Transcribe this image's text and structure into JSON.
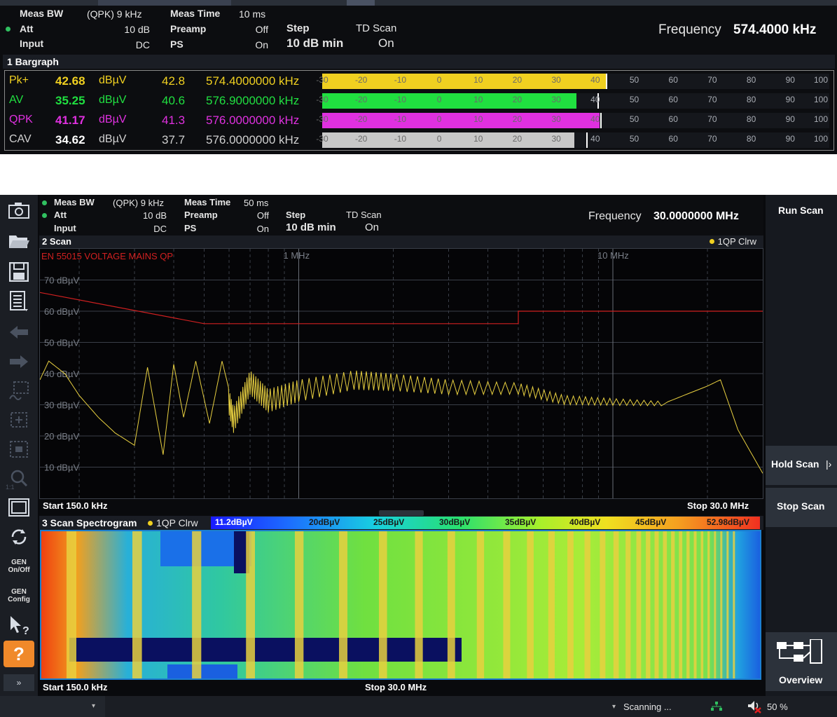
{
  "top": {
    "settings": {
      "meas_bw_label": "Meas BW",
      "meas_bw_value": "(QPK) 9 kHz",
      "att_label": "Att",
      "att_value": "10 dB",
      "input_label": "Input",
      "input_value": "DC",
      "meas_time_label": "Meas Time",
      "meas_time_value": "10 ms",
      "preamp_label": "Preamp",
      "preamp_value": "Off",
      "ps_label": "PS",
      "ps_value": "On",
      "step_label": "Step",
      "step_value": "10 dB min",
      "td_scan_label": "TD Scan",
      "td_scan_value": "On"
    },
    "frequency_label": "Frequency",
    "frequency_value": "574.4000 kHz",
    "bargraph_title": "1 Bargraph",
    "scale_ticks": [
      "-30",
      "-20",
      "-10",
      "0",
      "10",
      "20",
      "30",
      "40",
      "50",
      "60",
      "70",
      "80",
      "90",
      "100"
    ],
    "scale_min": -30,
    "scale_max": 100,
    "rows": [
      {
        "detector": "Pk+",
        "value": "42.68",
        "unit": "dBµV",
        "peak": "42.8",
        "peak_freq": "574.4000000 kHz",
        "level": 42.68,
        "color": "#f0d020"
      },
      {
        "detector": "AV",
        "value": "35.25",
        "unit": "dBµV",
        "peak": "40.6",
        "peak_freq": "576.9000000 kHz",
        "level": 35.25,
        "color": "#20e040"
      },
      {
        "detector": "QPK",
        "value": "41.17",
        "unit": "dBµV",
        "peak": "41.3",
        "peak_freq": "576.0000000 kHz",
        "level": 41.17,
        "color": "#e030e0"
      },
      {
        "detector": "CAV",
        "value": "34.62",
        "unit": "dBµV",
        "peak": "37.7",
        "peak_freq": "576.0000000 kHz",
        "level": 34.62,
        "color": "#c8c8c8"
      }
    ]
  },
  "bottom": {
    "settings": {
      "meas_bw_label": "Meas BW",
      "meas_bw_value": "(QPK) 9 kHz",
      "att_label": "Att",
      "att_value": "10 dB",
      "input_label": "Input",
      "input_value": "DC",
      "meas_time_label": "Meas Time",
      "meas_time_value": "50 ms",
      "preamp_label": "Preamp",
      "preamp_value": "Off",
      "ps_label": "PS",
      "ps_value": "On",
      "step_label": "Step",
      "step_value": "10 dB min",
      "td_scan_label": "TD Scan",
      "td_scan_value": "On"
    },
    "frequency_label": "Frequency",
    "frequency_value": "30.0000000 MHz",
    "scan_title": "2 Scan",
    "trace_label": "1QP Clrw",
    "limit_line_label": "EN 55015 VOLTAGE MAINS QP",
    "freq_marks": [
      "1 MHz",
      "10 MHz"
    ],
    "y_labels": [
      "70 dBµV",
      "60 dBµV",
      "50 dBµV",
      "40 dBµV",
      "30 dBµV",
      "20 dBµV",
      "10 dBµV"
    ],
    "start_label": "Start 150.0 kHz",
    "stop_label": "Stop 30.0 MHz",
    "spectrogram_title": "3 Scan Spectrogram",
    "colorbar_labels": [
      "11.2dBµV",
      "20dBµV",
      "25dBµV",
      "30dBµV",
      "35dBµV",
      "40dBµV",
      "45dBµV",
      "52.98dBµV"
    ],
    "spec_start_label": "Start 150.0 kHz",
    "spec_stop_label": "Stop 30.0 MHz"
  },
  "chart_data": {
    "type": "line",
    "title": "2 Scan",
    "xlabel": "",
    "ylabel": "",
    "x_scale": "log",
    "xlim_hz": [
      150000,
      30000000
    ],
    "ylim": [
      0,
      80
    ],
    "grid": true,
    "series": [
      {
        "name": "1QP Clrw",
        "x_hz": [
          150000,
          160000,
          180000,
          200000,
          230000,
          260000,
          300000,
          330000,
          370000,
          400000,
          430000,
          470000,
          520000,
          570000,
          620000,
          700000,
          800000,
          1000000,
          1500000,
          2000000,
          3000000,
          5000000,
          7000000,
          10000000,
          15000000,
          20000000,
          22000000,
          25000000,
          30000000
        ],
        "y_dbuv": [
          38,
          44,
          40,
          33,
          26,
          21,
          17,
          42,
          14,
          43,
          26,
          44,
          24,
          44,
          29,
          41,
          35,
          38,
          41,
          40,
          38,
          37,
          33,
          32,
          31,
          36,
          38,
          22,
          8
        ]
      }
    ],
    "limit_line": {
      "name": "EN 55015 VOLTAGE MAINS QP",
      "x_hz": [
        150000,
        500000,
        5000000,
        5000000,
        30000000
      ],
      "y_dbuv": [
        66,
        56,
        56,
        60,
        60
      ]
    }
  },
  "toolbar_labels": {
    "gen_onoff": "GEN On/Off",
    "gen_config": "GEN Config",
    "zoom_11": "1:1"
  },
  "right_panel": {
    "run_scan": "Run Scan",
    "hold_scan": "Hold Scan",
    "stop_scan": "Stop Scan",
    "overview": "Overview"
  },
  "status": {
    "scanning": "Scanning ...",
    "volume": "50 %"
  }
}
